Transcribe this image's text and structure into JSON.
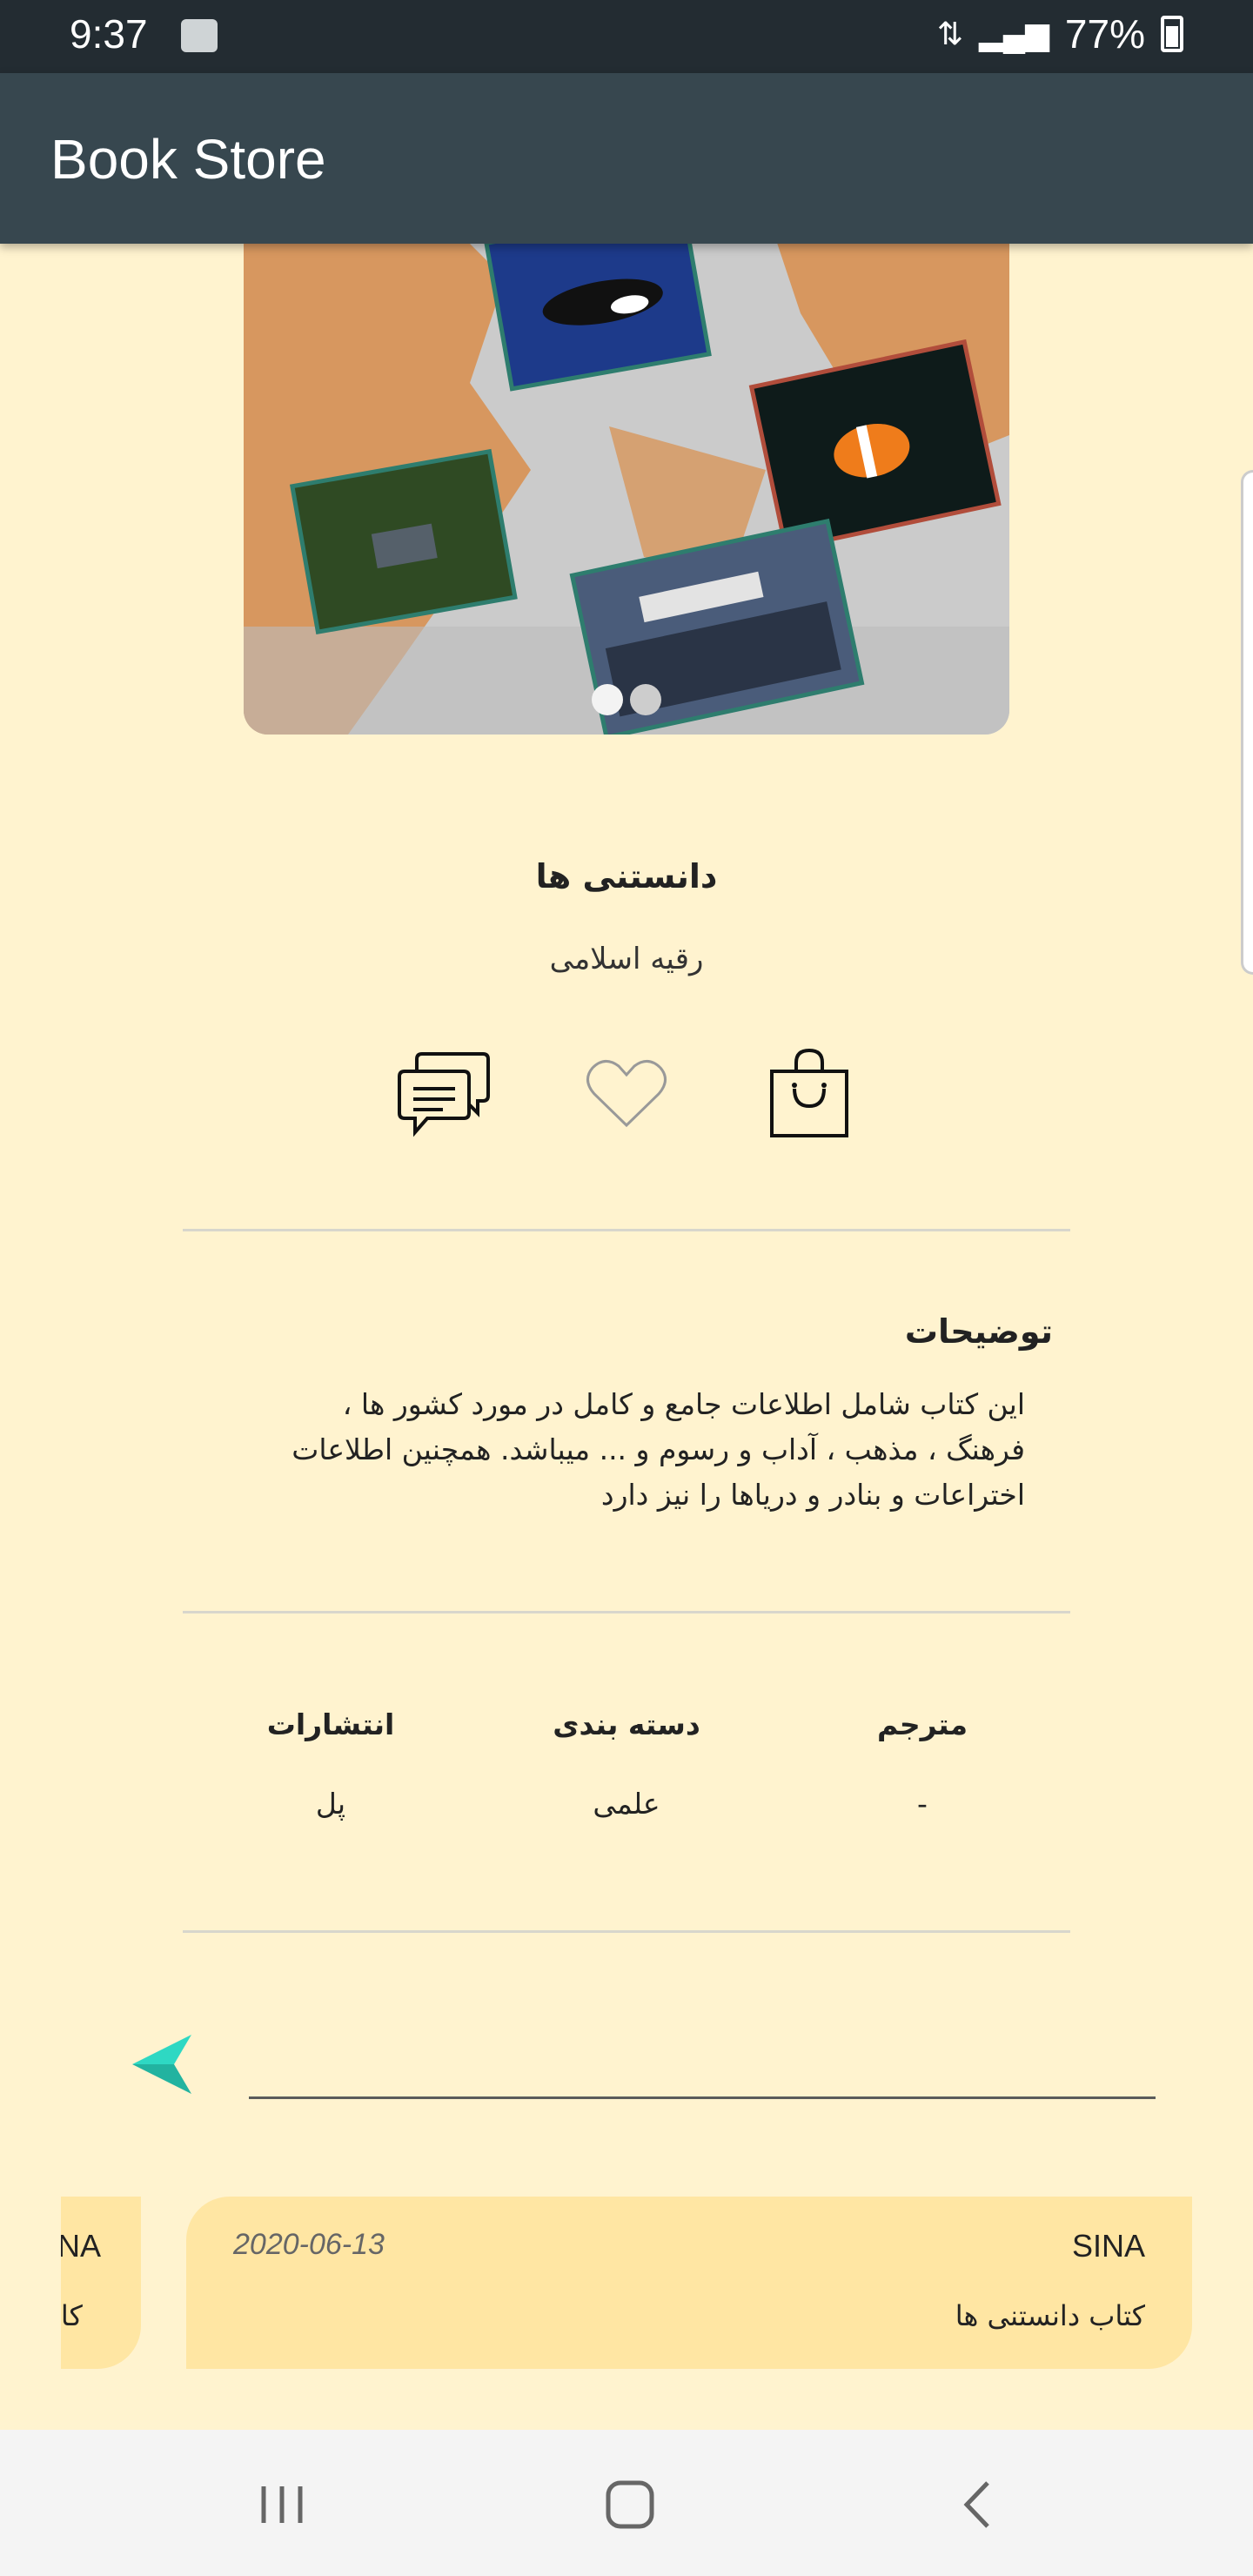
{
  "status_bar": {
    "time": "9:37",
    "battery": "77%"
  },
  "app_bar": {
    "title": "Book Store"
  },
  "book": {
    "title": "دانستنی ها",
    "author": "رقیه اسلامی",
    "image_pager": {
      "total": 2,
      "active": 1
    }
  },
  "description": {
    "heading": "توضیحات",
    "lines": [
      "این کتاب شامل اطلاعات جامع و کامل در مورد کشور ها ،",
      "فرهنگ ، مذهب ، آداب و رسوم و ... میباشد. همچنین اطلاعات",
      "اختراعات و بنادر و دریاها را نیز دارد"
    ]
  },
  "meta": {
    "translator": {
      "label": "مترجم",
      "value": "-"
    },
    "category": {
      "label": "دسته بندی",
      "value": "علمی"
    },
    "publisher": {
      "label": "انتشارات",
      "value": "پل"
    }
  },
  "comment_form": {
    "input_value": ""
  },
  "comments": [
    {
      "user": "SINA",
      "date": "2020-06-13",
      "text": "کتاب دانستنی ها"
    },
    {
      "user": "NA",
      "text": "کام"
    }
  ],
  "colors": {
    "background": "#FFF3CF",
    "app_bar": "#37474F",
    "status_bar": "#232C32",
    "comment_card": "#FFE6A3",
    "send_accent": "#2ED8C3"
  }
}
